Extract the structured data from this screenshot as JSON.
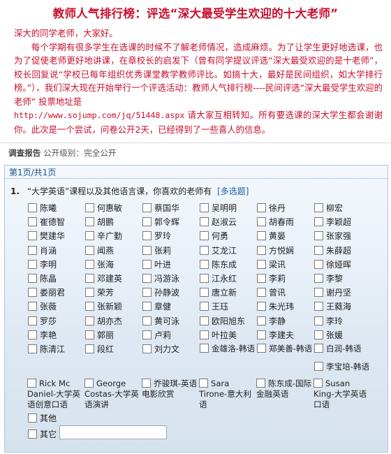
{
  "title": "教师人气排行榜：评选“深大最受学生欢迎的十大老师”",
  "intro": {
    "greeting": "深大的同学老师，大家好。",
    "para_a": "每个学期有很多学生在选课的时候不了解老师情况，造成麻烦。为了让学生更好地选课，也为了促使老师更好地讲课，在章校长的启发下（曾有同学提议评选“深大最受欢迎的是十老师”，校长回复说“学校已每年组织优秀课堂教学教师评比。如搞十大，最好是民间组织，如大学排行榜。”），我们深大现在开始举行一个评选活动：教师人气排行榜----民间评选“深大最受学生欢迎的老师” 投票地址是",
    "url": "http://www.sojump.com/jq/51448.aspx",
    "para_b": " 请大家互相转知。所有要选课的深大学生都会谢谢你。此次是一个尝试，问卷公开2天，已经得到了一些喜人的信息。"
  },
  "report_bar": {
    "label": "调查报告",
    "public_level": "公开级别：完全公开"
  },
  "page_indicator": "第1页/共1页",
  "question": {
    "number": "1.",
    "text": "“大学英语”课程以及其他语言课，你喜欢的老师有",
    "type_label": "[多选题]"
  },
  "options": [
    "陈曦",
    "何惠敏",
    "蔡国华",
    "吴明明",
    "徐丹",
    "柳宏",
    "崔德智",
    "胡鹏",
    "郭令辉",
    "赵淑云",
    "胡春雨",
    "李颖超",
    "樊建华",
    "辛广勤",
    "罗玲",
    "何勇",
    "黄晏",
    "张家强",
    "肖涵",
    "闻燕",
    "张莉",
    "艾龙江",
    "方悦娴",
    "朱薛超",
    "李明",
    "张海",
    "叶进",
    "陈东成",
    "梁讯",
    "徐娅晖",
    "陈晶",
    "邓建英",
    "冯游泳",
    "江永红",
    "李莉",
    "李黎",
    "娄丽君",
    "荣芳",
    "孙静波",
    "唐立新",
    "曾讯",
    "谢丹坚",
    "张薇",
    "张新颖",
    "章健",
    "王珏",
    "朱光玮",
    "王蕤海",
    "罗莎",
    "胡亦杰",
    "黄可泳",
    "欧阳旭东",
    "李静",
    "李玲",
    "李艳",
    "郭丽",
    "卢莉",
    "叶拉美",
    "李建夫",
    "张媛",
    "陈清江",
    "段红",
    "刘力文",
    "金雄洛-韩语",
    "郑美善-韩语",
    "白润-韩语",
    "李宝培-韩语",
    "Rick Mc Daniel-大学英语创意口语",
    "George Costas-大学英语演讲",
    "乔骏琪-英语电影欣赏",
    "Sara Tirone-意大利语",
    "陈东成-国际金融英语",
    "Susan King-大学英语口语",
    "其他",
    "其它"
  ],
  "other_input_value": ""
}
